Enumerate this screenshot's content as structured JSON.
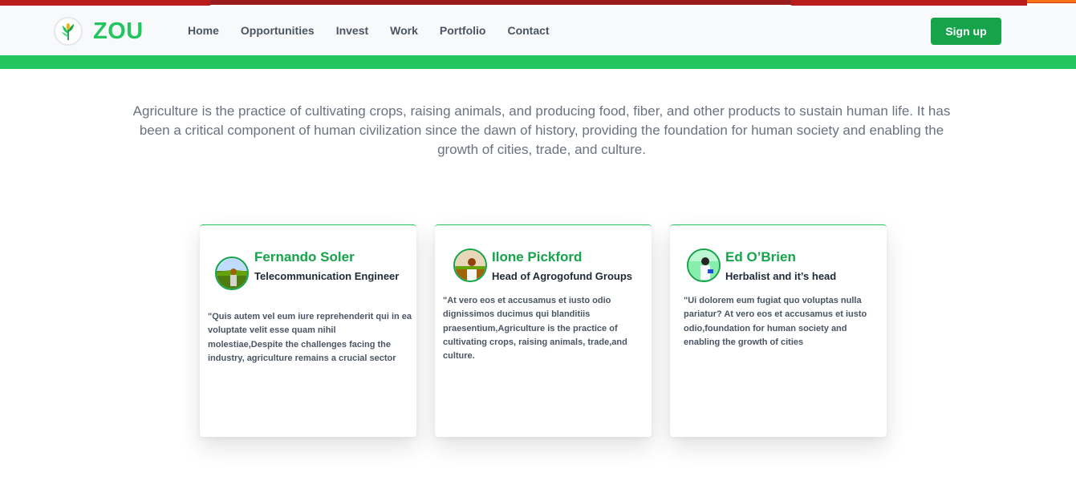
{
  "brand": {
    "name": "ZOU",
    "logo_icon": "maize-plant-icon"
  },
  "nav": {
    "items": [
      "Home",
      "Opportunities",
      "Invest",
      "Work",
      "Portfolio",
      "Contact"
    ],
    "signup_label": "Sign up"
  },
  "colors": {
    "accent": "#22c55e",
    "accent_dark": "#16a34a",
    "top_strip": "#b91c1c"
  },
  "intro": {
    "text": "Agriculture is the practice of cultivating crops, raising animals, and producing food, fiber, and other products to sustain human life. It has been a critical component of human civilization since the dawn of history, providing the foundation for human society and enabling the growth of cities, trade, and culture."
  },
  "testimonials": [
    {
      "name": "Fernando Soler",
      "role": "Telecommunication Engineer",
      "quote": "\"Quis autem vel eum iure reprehenderit qui in ea voluptate velit esse quam nihil molestiae,Despite the challenges facing the industry, agriculture remains a crucial sector"
    },
    {
      "name": "Ilone Pickford",
      "role": "Head of Agrogofund Groups",
      "quote": "\"At vero eos et accusamus et iusto odio dignissimos ducimus qui blanditiis praesentium,Agriculture is the practice of cultivating crops, raising animals, trade,and culture."
    },
    {
      "name": "Ed O’Brien",
      "role": "Herbalist and it’s head",
      "quote": "\"Ui dolorem eum fugiat quo voluptas nulla pariatur? At vero eos et accusamus et iusto odio,foundation for human society and enabling the growth of cities"
    }
  ]
}
